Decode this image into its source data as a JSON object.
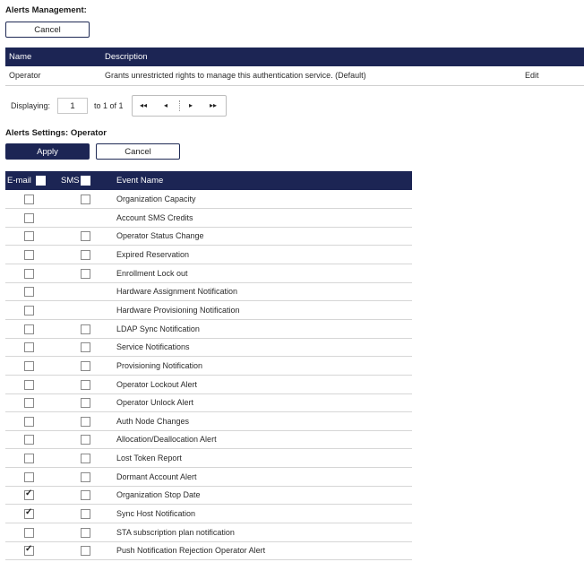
{
  "alerts_management": {
    "title": "Alerts Management:",
    "cancel_label": "Cancel"
  },
  "operator_table": {
    "headers": {
      "name": "Name",
      "description": "Description"
    },
    "rows": [
      {
        "name": "Operator",
        "description": "Grants unrestricted rights to manage this authentication service. (Default)",
        "action": "Edit"
      }
    ]
  },
  "paging": {
    "displaying_label": "Displaying:",
    "page_value": "1",
    "range_text": "to 1 of 1",
    "first": "◂◂",
    "prev": "◂",
    "next": "▸",
    "last": "▸▸"
  },
  "alerts_settings": {
    "title": "Alerts Settings: Operator",
    "apply_label": "Apply",
    "cancel_label": "Cancel"
  },
  "events_table": {
    "headers": {
      "email": "E-mail",
      "sms": "SMS",
      "event_name": "Event Name"
    },
    "rows": [
      {
        "name": "Organization Capacity",
        "email": false,
        "sms": false,
        "has_sms": true
      },
      {
        "name": "Account SMS Credits",
        "email": false,
        "sms": false,
        "has_sms": false
      },
      {
        "name": "Operator Status Change",
        "email": false,
        "sms": false,
        "has_sms": true
      },
      {
        "name": "Expired Reservation",
        "email": false,
        "sms": false,
        "has_sms": true
      },
      {
        "name": "Enrollment Lock out",
        "email": false,
        "sms": false,
        "has_sms": true
      },
      {
        "name": "Hardware Assignment Notification",
        "email": false,
        "sms": false,
        "has_sms": false
      },
      {
        "name": "Hardware Provisioning Notification",
        "email": false,
        "sms": false,
        "has_sms": false
      },
      {
        "name": "LDAP Sync Notification",
        "email": false,
        "sms": false,
        "has_sms": true
      },
      {
        "name": "Service Notifications",
        "email": false,
        "sms": false,
        "has_sms": true
      },
      {
        "name": "Provisioning Notification",
        "email": false,
        "sms": false,
        "has_sms": true
      },
      {
        "name": "Operator Lockout Alert",
        "email": false,
        "sms": false,
        "has_sms": true
      },
      {
        "name": "Operator Unlock Alert",
        "email": false,
        "sms": false,
        "has_sms": true
      },
      {
        "name": "Auth Node Changes",
        "email": false,
        "sms": false,
        "has_sms": true
      },
      {
        "name": "Allocation/Deallocation Alert",
        "email": false,
        "sms": false,
        "has_sms": true
      },
      {
        "name": "Lost Token Report",
        "email": false,
        "sms": false,
        "has_sms": true
      },
      {
        "name": "Dormant Account Alert",
        "email": false,
        "sms": false,
        "has_sms": true
      },
      {
        "name": "Organization Stop Date",
        "email": true,
        "sms": false,
        "has_sms": true
      },
      {
        "name": "Sync Host Notification",
        "email": true,
        "sms": false,
        "has_sms": true
      },
      {
        "name": "STA subscription plan notification",
        "email": false,
        "sms": false,
        "has_sms": true
      },
      {
        "name": "Push Notification Rejection Operator Alert",
        "email": true,
        "sms": false,
        "has_sms": true
      }
    ]
  }
}
